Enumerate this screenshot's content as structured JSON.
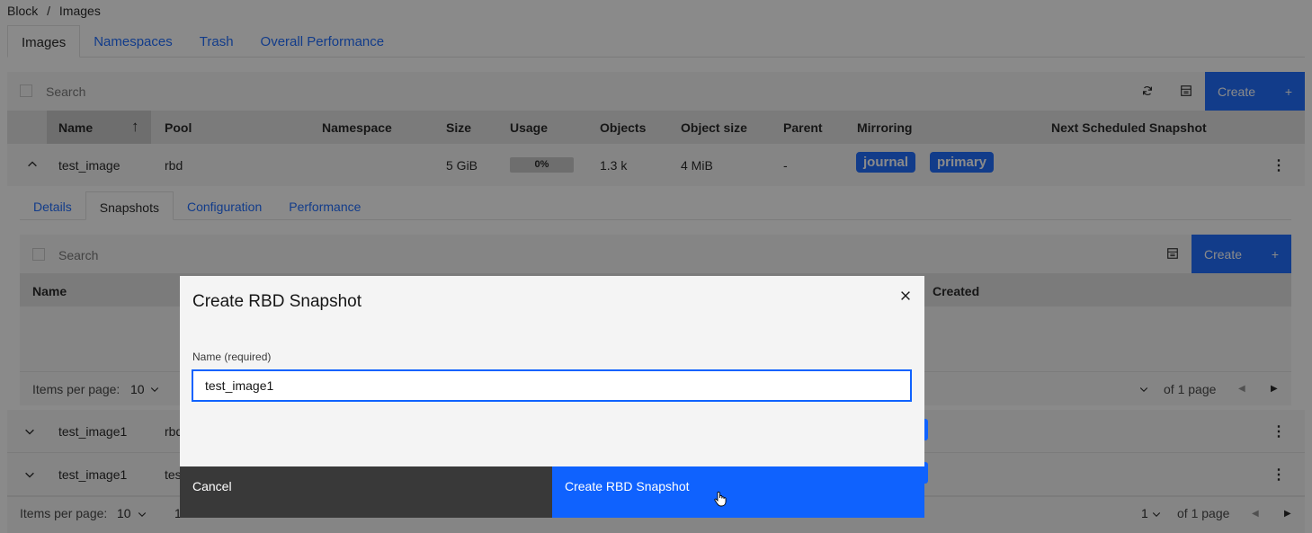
{
  "breadcrumb": {
    "items": [
      "Block",
      "/",
      "Images"
    ]
  },
  "tabs": [
    {
      "label": "Images",
      "active": true
    },
    {
      "label": "Namespaces"
    },
    {
      "label": "Trash"
    },
    {
      "label": "Overall Performance"
    }
  ],
  "toolbar": {
    "search_placeholder": "Search",
    "create_label": "Create",
    "create_icon": "+"
  },
  "table": {
    "columns": [
      "Name",
      "Pool",
      "Namespace",
      "Size",
      "Usage",
      "Objects",
      "Object size",
      "Parent",
      "Mirroring",
      "Next Scheduled Snapshot"
    ],
    "sort_icon": "↑",
    "rows": [
      {
        "name": "test_image",
        "pool": "rbd",
        "size": "5 GiB",
        "usage": "0%",
        "objects": "1.3 k",
        "object_size": "4 MiB",
        "parent": "-",
        "tags": [
          "journal",
          "primary"
        ]
      },
      {
        "name": "test_image1",
        "pool": "rbd"
      },
      {
        "name": "test_image1",
        "pool": "tes"
      }
    ]
  },
  "details": {
    "tabs": [
      "Details",
      "Snapshots",
      "Configuration",
      "Performance"
    ],
    "search_placeholder": "Search",
    "create_label": "Create",
    "create_icon": "+",
    "columns": [
      "Name",
      "Created"
    ],
    "pager": {
      "items_per_page_label": "Items per page:",
      "items_per_page": "10",
      "of_pages": "of 1 page"
    }
  },
  "footer_pager": {
    "items_per_page_label": "Items per page:",
    "items_per_page": "10",
    "page_fragment": "1",
    "page": "1",
    "of_pages": "of 1 page"
  },
  "modal": {
    "title": "Create RBD Snapshot",
    "name_label": "Name (required)",
    "name_value": "test_image1",
    "cancel_label": "Cancel",
    "submit_label": "Create RBD Snapshot"
  },
  "colors": {
    "primary": "#0f62fe",
    "cancel": "#393939"
  }
}
